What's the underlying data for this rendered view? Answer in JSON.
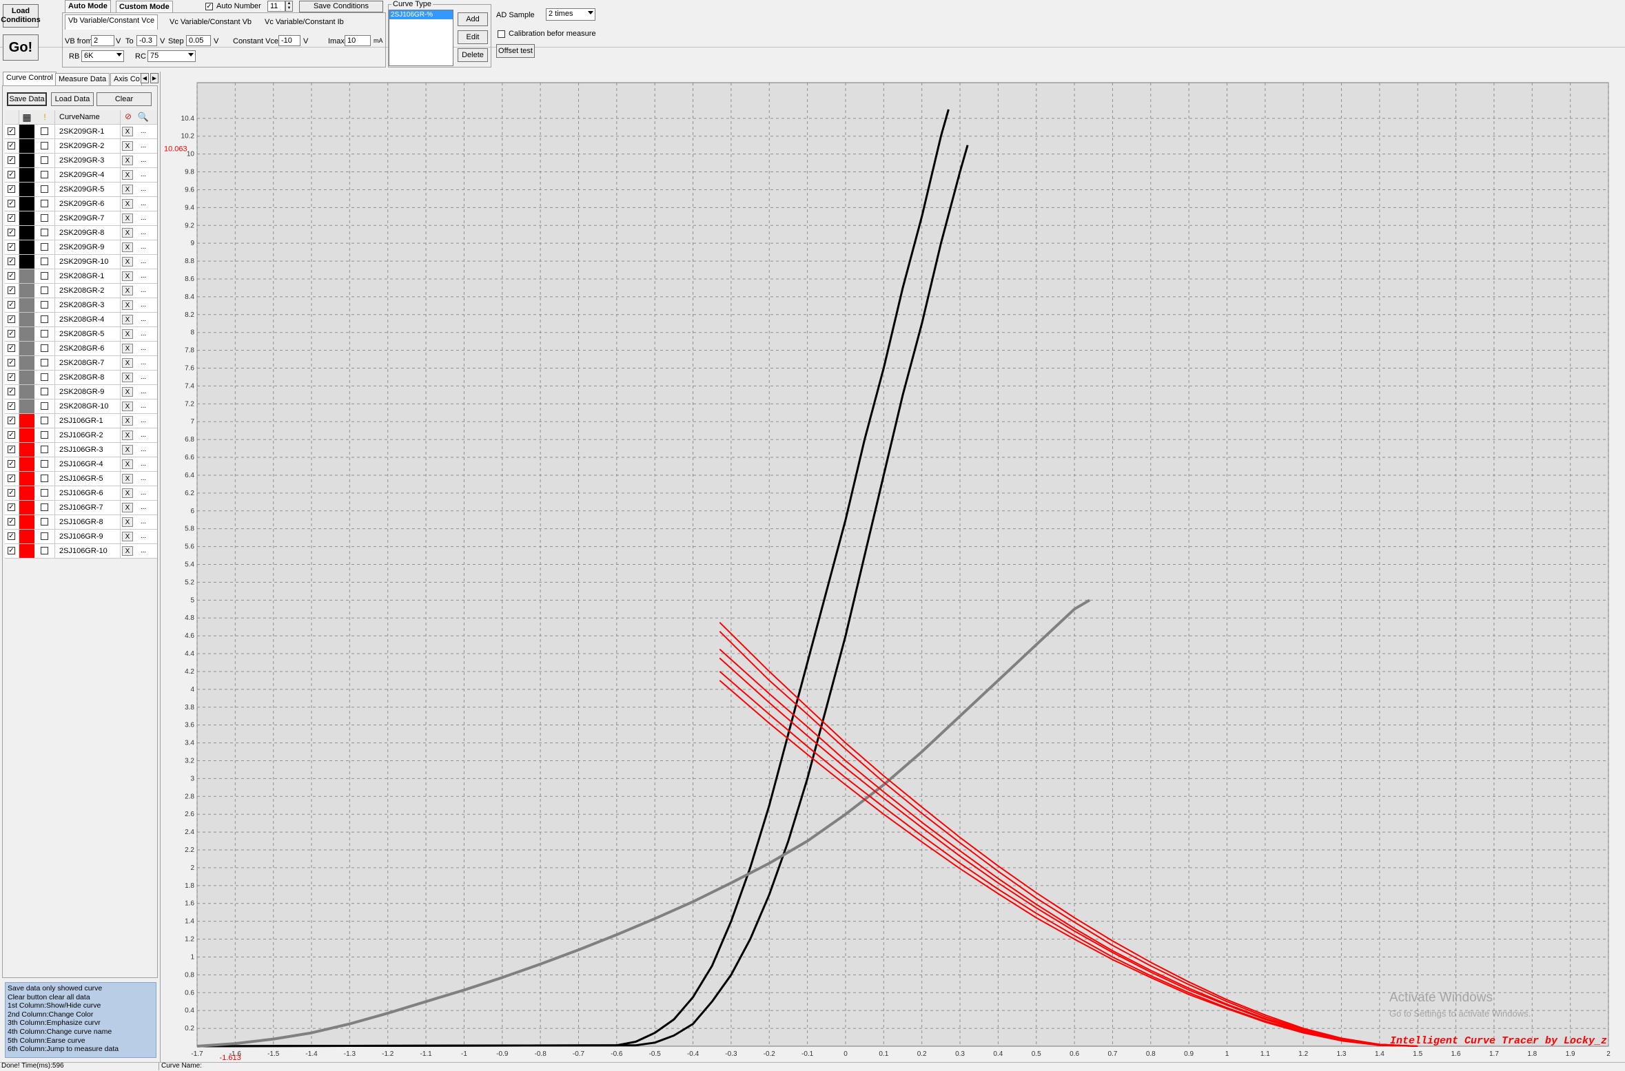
{
  "toolbar": {
    "load_conditions": "Load Conditions",
    "go": "Go!",
    "auto_mode_tab": "Auto Mode",
    "custom_mode_tab": "Custom Mode",
    "auto_number_label": "Auto Number",
    "auto_number_value": "11",
    "save_conditions": "Save Conditions",
    "subtab_vb": "Vb Variable/Constant Vce",
    "subtab_vc_vb": "Vc Variable/Constant Vb",
    "subtab_vc_ib": "Vc Variable/Constant Ib",
    "vb_from_label": "VB from",
    "vb_from_value": "2",
    "v1": "V",
    "to_label": "To",
    "to_value": "-0.3",
    "v2": "V",
    "step_label": "Step",
    "step_value": "0.05",
    "v3": "V",
    "constant_vce_label": "Constant Vce",
    "constant_vce_value": "-10",
    "v4": "V",
    "imax_label": "Imax",
    "imax_value": "10",
    "ma": "mA",
    "rb_label": "RB",
    "rb_value": "6K",
    "rc_label": "RC",
    "rc_value": "75",
    "curve_type_label": "Curve Type",
    "curve_type_item": "2SJ106GR-%",
    "add": "Add",
    "edit": "Edit",
    "delete": "Delete",
    "ad_sample_label": "AD Sample",
    "ad_sample_value": "2 times",
    "calibration_label": "Calibration befor measure",
    "offset_test": "Offset test"
  },
  "left_panel": {
    "tabs": [
      "Curve Control",
      "Measure Data",
      "Axis Co"
    ],
    "save_data": "Save Data",
    "load_data": "Load Data",
    "clear": "Clear",
    "col_name_header": "CurveName",
    "erase_label": "X",
    "jump_label": "...",
    "rows": [
      {
        "name": "2SK209GR-1",
        "color": "#000000"
      },
      {
        "name": "2SK209GR-2",
        "color": "#000000"
      },
      {
        "name": "2SK209GR-3",
        "color": "#000000"
      },
      {
        "name": "2SK209GR-4",
        "color": "#000000"
      },
      {
        "name": "2SK209GR-5",
        "color": "#000000"
      },
      {
        "name": "2SK209GR-6",
        "color": "#000000"
      },
      {
        "name": "2SK209GR-7",
        "color": "#000000"
      },
      {
        "name": "2SK209GR-8",
        "color": "#000000"
      },
      {
        "name": "2SK209GR-9",
        "color": "#000000"
      },
      {
        "name": "2SK209GR-10",
        "color": "#000000"
      },
      {
        "name": "2SK208GR-1",
        "color": "#808080"
      },
      {
        "name": "2SK208GR-2",
        "color": "#808080"
      },
      {
        "name": "2SK208GR-3",
        "color": "#808080"
      },
      {
        "name": "2SK208GR-4",
        "color": "#808080"
      },
      {
        "name": "2SK208GR-5",
        "color": "#808080"
      },
      {
        "name": "2SK208GR-6",
        "color": "#808080"
      },
      {
        "name": "2SK208GR-7",
        "color": "#808080"
      },
      {
        "name": "2SK208GR-8",
        "color": "#808080"
      },
      {
        "name": "2SK208GR-9",
        "color": "#808080"
      },
      {
        "name": "2SK208GR-10",
        "color": "#808080"
      },
      {
        "name": "2SJ106GR-1",
        "color": "#ff0000"
      },
      {
        "name": "2SJ106GR-2",
        "color": "#ff0000"
      },
      {
        "name": "2SJ106GR-3",
        "color": "#ff0000"
      },
      {
        "name": "2SJ106GR-4",
        "color": "#ff0000"
      },
      {
        "name": "2SJ106GR-5",
        "color": "#ff0000"
      },
      {
        "name": "2SJ106GR-6",
        "color": "#ff0000"
      },
      {
        "name": "2SJ106GR-7",
        "color": "#ff0000"
      },
      {
        "name": "2SJ106GR-8",
        "color": "#ff0000"
      },
      {
        "name": "2SJ106GR-9",
        "color": "#ff0000"
      },
      {
        "name": "2SJ106GR-10",
        "color": "#ff0000"
      }
    ],
    "help_lines": [
      " Save data only showed curve",
      " Clear button clear all data",
      "1st Column:Show/Hide curve",
      "2nd Column:Change Color",
      "3th Column:Emphasize curvr",
      "4th Column:Change curve name",
      "5th Column:Earse curve",
      "6th Column:Jump to measure data"
    ]
  },
  "status": {
    "left": "Done!  Time(ms):596",
    "curve_name": "Curve Name:"
  },
  "watermark": {
    "title": "Activate Windows",
    "subtitle": "Go to Settings to activate Windows."
  },
  "chart_data": {
    "type": "line",
    "xlim": [
      -1.7,
      2.0
    ],
    "ylim": [
      0,
      10.8
    ],
    "y_marker": "10.063",
    "x_marker": "-1.613",
    "x_ticks": [
      "-1.7",
      "-1.6",
      "-1.5",
      "-1.4",
      "-1.3",
      "-1.2",
      "-1.1",
      "-1",
      "-0.9",
      "-0.8",
      "-0.7",
      "-0.6",
      "-0.5",
      "-0.4",
      "-0.3",
      "-0.2",
      "-0.1",
      "0",
      "0.1",
      "0.2",
      "0.3",
      "0.4",
      "0.5",
      "0.6",
      "0.7",
      "0.8",
      "0.9",
      "1",
      "1.1",
      "1.2",
      "1.3",
      "1.4",
      "1.5",
      "1.6",
      "1.7",
      "1.8",
      "1.9",
      "2"
    ],
    "y_ticks": [
      "0.2",
      "0.4",
      "0.6",
      "0.8",
      "1",
      "1.2",
      "1.4",
      "1.6",
      "1.8",
      "2",
      "2.2",
      "2.4",
      "2.6",
      "2.8",
      "3",
      "3.2",
      "3.4",
      "3.6",
      "3.8",
      "4",
      "4.2",
      "4.4",
      "4.6",
      "4.8",
      "5",
      "5.2",
      "5.4",
      "5.6",
      "5.8",
      "6",
      "6.2",
      "6.4",
      "6.6",
      "6.8",
      "7",
      "7.2",
      "7.4",
      "7.6",
      "7.8",
      "8",
      "8.2",
      "8.4",
      "8.6",
      "8.8",
      "9",
      "9.2",
      "9.4",
      "9.6",
      "9.8",
      "10",
      "10.2",
      "10.4"
    ],
    "grid": true,
    "brand": "Intelligent Curve Tracer by Locky_z",
    "series": [
      {
        "group": "2SK209GR",
        "color": "#000000",
        "x": [
          -1.7,
          -0.6,
          -0.55,
          -0.5,
          -0.45,
          -0.4,
          -0.35,
          -0.3,
          -0.25,
          -0.2,
          -0.15,
          -0.1,
          -0.05,
          0,
          0.05,
          0.1,
          0.15,
          0.2,
          0.25,
          0.27
        ],
        "y": [
          0,
          0.01,
          0.05,
          0.15,
          0.3,
          0.55,
          0.9,
          1.4,
          2.0,
          2.7,
          3.5,
          4.3,
          5.1,
          5.9,
          6.8,
          7.6,
          8.5,
          9.3,
          10.2,
          10.5
        ]
      },
      {
        "group": "2SK209GR",
        "color": "#000000",
        "x": [
          -1.7,
          -0.55,
          -0.5,
          -0.45,
          -0.4,
          -0.35,
          -0.3,
          -0.25,
          -0.2,
          -0.15,
          -0.1,
          -0.05,
          0,
          0.05,
          0.1,
          0.15,
          0.2,
          0.25,
          0.3,
          0.32
        ],
        "y": [
          0,
          0.01,
          0.04,
          0.12,
          0.25,
          0.5,
          0.8,
          1.2,
          1.7,
          2.3,
          3.0,
          3.8,
          4.6,
          5.5,
          6.4,
          7.3,
          8.1,
          9.0,
          9.8,
          10.1
        ]
      },
      {
        "group": "2SK208GR",
        "color": "#808080",
        "x": [
          -1.7,
          -1.6,
          -1.5,
          -1.4,
          -1.3,
          -1.2,
          -1.1,
          -1.0,
          -0.9,
          -0.8,
          -0.7,
          -0.6,
          -0.5,
          -0.4,
          -0.3,
          -0.2,
          -0.1,
          0,
          0.1,
          0.2,
          0.3,
          0.4,
          0.5,
          0.6,
          0.64
        ],
        "y": [
          0,
          0.03,
          0.08,
          0.15,
          0.25,
          0.37,
          0.5,
          0.63,
          0.77,
          0.92,
          1.08,
          1.25,
          1.43,
          1.62,
          1.83,
          2.05,
          2.3,
          2.6,
          2.93,
          3.3,
          3.7,
          4.1,
          4.5,
          4.9,
          5.0
        ]
      },
      {
        "group": "2SJ106GR",
        "color": "#ff0000",
        "x": [
          -0.33,
          -0.2,
          -0.1,
          0,
          0.1,
          0.2,
          0.3,
          0.4,
          0.5,
          0.6,
          0.7,
          0.8,
          0.9,
          1.0,
          1.1,
          1.2,
          1.3,
          1.4,
          1.5
        ],
        "y": [
          4.75,
          4.2,
          3.8,
          3.4,
          3.03,
          2.68,
          2.34,
          2.02,
          1.72,
          1.44,
          1.18,
          0.94,
          0.72,
          0.52,
          0.35,
          0.2,
          0.09,
          0.02,
          0
        ]
      },
      {
        "group": "2SJ106GR",
        "color": "#ff0000",
        "x": [
          -0.33,
          -0.2,
          -0.1,
          0,
          0.1,
          0.2,
          0.3,
          0.4,
          0.5,
          0.6,
          0.7,
          0.8,
          0.9,
          1.0,
          1.1,
          1.2,
          1.3,
          1.4,
          1.5
        ],
        "y": [
          4.65,
          4.1,
          3.72,
          3.33,
          2.96,
          2.61,
          2.28,
          1.96,
          1.66,
          1.39,
          1.13,
          0.9,
          0.69,
          0.5,
          0.33,
          0.19,
          0.08,
          0.02,
          0
        ]
      },
      {
        "group": "2SJ106GR",
        "color": "#ff0000",
        "x": [
          -0.33,
          -0.2,
          -0.1,
          0,
          0.1,
          0.2,
          0.3,
          0.4,
          0.5,
          0.6,
          0.7,
          0.8,
          0.9,
          1.0,
          1.1,
          1.2,
          1.3,
          1.4,
          1.5
        ],
        "y": [
          4.45,
          3.95,
          3.58,
          3.2,
          2.85,
          2.51,
          2.19,
          1.88,
          1.59,
          1.32,
          1.07,
          0.85,
          0.65,
          0.47,
          0.31,
          0.18,
          0.08,
          0.02,
          0
        ]
      },
      {
        "group": "2SJ106GR",
        "color": "#ff0000",
        "x": [
          -0.33,
          -0.2,
          -0.1,
          0,
          0.1,
          0.2,
          0.3,
          0.4,
          0.5,
          0.6,
          0.7,
          0.8,
          0.9,
          1.0,
          1.1,
          1.2,
          1.3,
          1.4,
          1.5
        ],
        "y": [
          4.35,
          3.85,
          3.48,
          3.12,
          2.78,
          2.45,
          2.13,
          1.83,
          1.55,
          1.29,
          1.05,
          0.83,
          0.63,
          0.46,
          0.3,
          0.17,
          0.07,
          0.02,
          0
        ]
      },
      {
        "group": "2SJ106GR",
        "color": "#ff0000",
        "x": [
          -0.33,
          -0.2,
          -0.1,
          0,
          0.1,
          0.2,
          0.3,
          0.4,
          0.5,
          0.6,
          0.7,
          0.8,
          0.9,
          1.0,
          1.1,
          1.2,
          1.3,
          1.4,
          1.5
        ],
        "y": [
          4.2,
          3.72,
          3.36,
          3.01,
          2.68,
          2.36,
          2.05,
          1.76,
          1.49,
          1.24,
          1.0,
          0.79,
          0.6,
          0.43,
          0.28,
          0.16,
          0.07,
          0.01,
          0
        ]
      },
      {
        "group": "2SJ106GR",
        "color": "#ff0000",
        "x": [
          -0.33,
          -0.2,
          -0.1,
          0,
          0.1,
          0.2,
          0.3,
          0.4,
          0.5,
          0.6,
          0.7,
          0.8,
          0.9,
          1.0,
          1.1,
          1.2,
          1.3,
          1.4,
          1.5
        ],
        "y": [
          4.1,
          3.62,
          3.27,
          2.93,
          2.6,
          2.29,
          1.99,
          1.71,
          1.44,
          1.2,
          0.97,
          0.77,
          0.58,
          0.42,
          0.27,
          0.15,
          0.06,
          0.01,
          0
        ]
      }
    ]
  }
}
